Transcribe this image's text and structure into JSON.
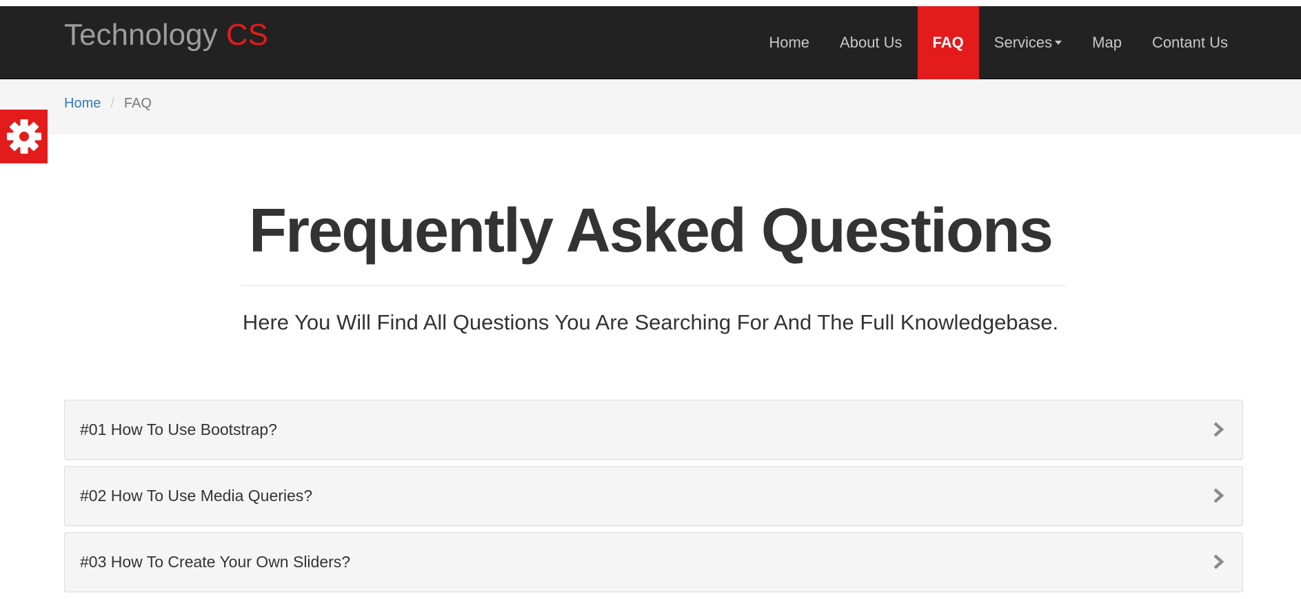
{
  "brand": {
    "name": "Technology",
    "accent": "CS"
  },
  "nav": {
    "items": [
      {
        "label": "Home"
      },
      {
        "label": "About Us"
      },
      {
        "label": "FAQ",
        "active": true
      },
      {
        "label": "Services",
        "has_dropdown": true
      },
      {
        "label": "Map"
      },
      {
        "label": "Contant Us"
      }
    ]
  },
  "breadcrumb": {
    "home": "Home",
    "separator": "/",
    "current": "FAQ"
  },
  "settings_icon": "gear-icon",
  "page": {
    "title": "Frequently Asked Questions",
    "subtitle": "Here You Will Find All Questions You Are Searching For And The Full Knowledgebase."
  },
  "faq": {
    "items": [
      {
        "question": "#01 How To Use Bootstrap?"
      },
      {
        "question": "#02 How To Use Media Queries?"
      },
      {
        "question": "#03 How To Create Your Own Sliders?"
      }
    ],
    "chevron_icon": "chevron-right-icon"
  },
  "colors": {
    "navbar": "#222222",
    "accent": "#e31b1b",
    "link": "#337ab7",
    "breadcrumb_bg": "#f5f5f5",
    "panel_bg": "#f5f5f5"
  }
}
